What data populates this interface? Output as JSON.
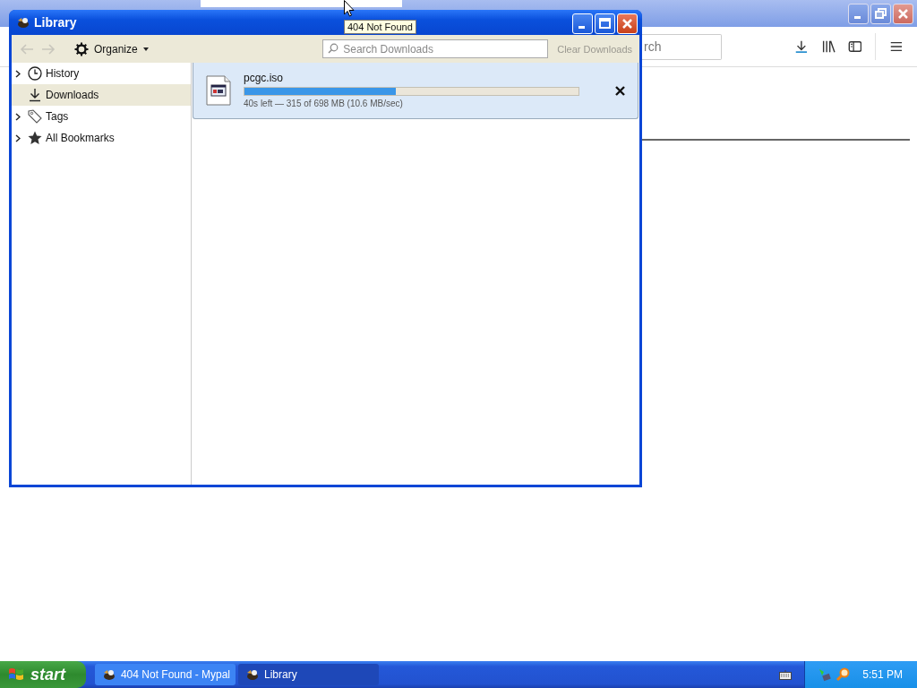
{
  "browser": {
    "search_text": "rch"
  },
  "tooltip": "404 Not Found",
  "library": {
    "title": "Library",
    "toolbar": {
      "organize": "Organize",
      "search_placeholder": "Search Downloads",
      "clear": {
        "label": "Clear Downloads",
        "disabled": true
      }
    },
    "sidebar": [
      {
        "label": "History",
        "kind": "history",
        "expandable": true,
        "selected": false
      },
      {
        "label": "Downloads",
        "kind": "downloads",
        "expandable": false,
        "selected": true
      },
      {
        "label": "Tags",
        "kind": "tags",
        "expandable": true,
        "selected": false
      },
      {
        "label": "All Bookmarks",
        "kind": "bookmarks",
        "expandable": true,
        "selected": false
      }
    ],
    "downloads": [
      {
        "name": "pcgc.iso",
        "level": 0.453,
        "status": "40s left — 315 of 698 MB (10.6 MB/sec)"
      }
    ]
  },
  "taskbar": {
    "start": "start",
    "tasks": [
      {
        "label": "404 Not Found - Mypal",
        "selected": false
      },
      {
        "label": "Library",
        "selected": true
      }
    ],
    "clock": "5:51 PM"
  }
}
